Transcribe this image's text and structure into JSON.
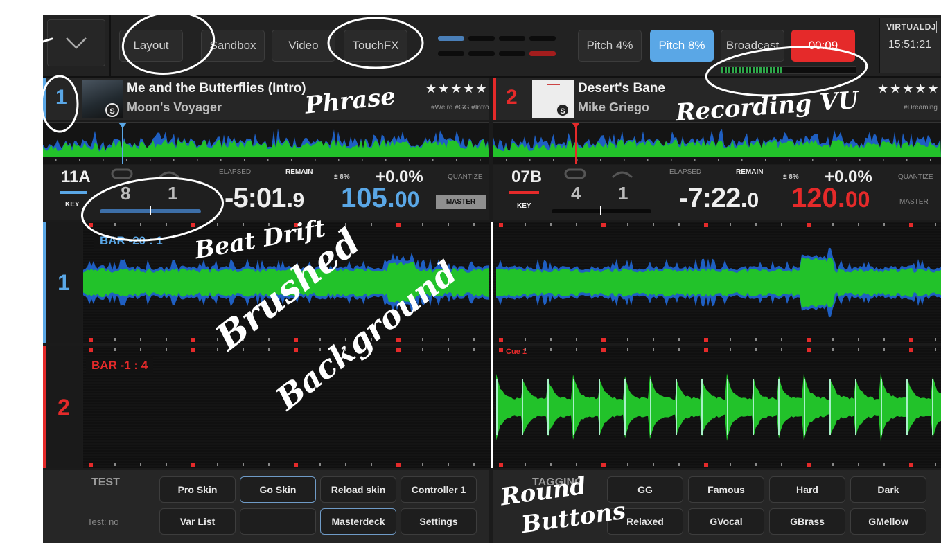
{
  "topbar": {
    "buttons": [
      {
        "label": "Layout"
      },
      {
        "label": "Sandbox"
      },
      {
        "label": "Video"
      },
      {
        "label": "TouchFX"
      }
    ],
    "pitch_buttons": [
      {
        "label": "Pitch 4%"
      },
      {
        "label": "Pitch 8%",
        "active": true
      }
    ],
    "broadcast_label": "Broadcast",
    "record_time": "00:09",
    "logo": "VIRTUALDJ",
    "clock": "15:51:21",
    "recording_vu_level": 0.46
  },
  "decks": [
    {
      "number": "1",
      "color": "#5aa7e6",
      "title": "Me and the Butterflies (Intro)",
      "artist": "Moon's Voyager",
      "stars": "★★★★★",
      "tags": "#Weird #GG #Intro",
      "key": "11A",
      "key_label": "KEY",
      "loop_length": "8",
      "loop_jump": "1",
      "elapsed_label": "ELAPSED",
      "remain_label": "REMAIN",
      "time_main": "-5:01.",
      "time_frac": "9",
      "pitch_range": "± 8%",
      "pitch_value": "+0.0%",
      "bpm_int": "105.",
      "bpm_frac": "00",
      "quantize_label": "QUANTIZE",
      "master_label": "MASTER",
      "bar_label": "BAR -20 : 1",
      "lane_number": "1"
    },
    {
      "number": "2",
      "color": "#e52a2a",
      "title": "Desert's Bane",
      "artist": "Mike Griego",
      "stars": "★★★★★",
      "tags": "#Dreaming",
      "key": "07B",
      "key_label": "KEY",
      "loop_length": "4",
      "loop_jump": "1",
      "elapsed_label": "ELAPSED",
      "remain_label": "REMAIN",
      "time_main": "-7:22.",
      "time_frac": "0",
      "pitch_range": "± 8%",
      "pitch_value": "+0.0%",
      "bpm_int": "120.",
      "bpm_frac": "00",
      "quantize_label": "QUANTIZE",
      "master_label": "MASTER",
      "bar_label": "BAR -1 : 4",
      "cue_label": "Cue 1",
      "lane_number": "2"
    }
  ],
  "thumb_text": "S",
  "test_panel": {
    "title": "TEST",
    "status": "Test: no",
    "buttons": [
      "Pro Skin",
      "Go Skin",
      "Reload skin",
      "Controller 1",
      "Var List",
      "",
      "Masterdeck",
      "Settings"
    ]
  },
  "tagging_panel": {
    "title": "TAGGING",
    "buttons": [
      "GG",
      "Famous",
      "Hard",
      "Dark",
      "Relaxed",
      "GVocal",
      "GBrass",
      "GMellow"
    ]
  },
  "annotations": {
    "phrase": "Phrase",
    "recording_vu": "Recording VU",
    "beat_drift": "Beat Drift",
    "brushed_line1": "Brushed",
    "brushed_line2": "Background",
    "round_line1": "Round",
    "round_line2": "Buttons"
  },
  "colors": {
    "deck1": "#5aa7e6",
    "deck2": "#e52a2a",
    "wave_green": "#22c22a",
    "wave_blue": "#1f5fc2",
    "wave_light": "#a8f0c8"
  }
}
